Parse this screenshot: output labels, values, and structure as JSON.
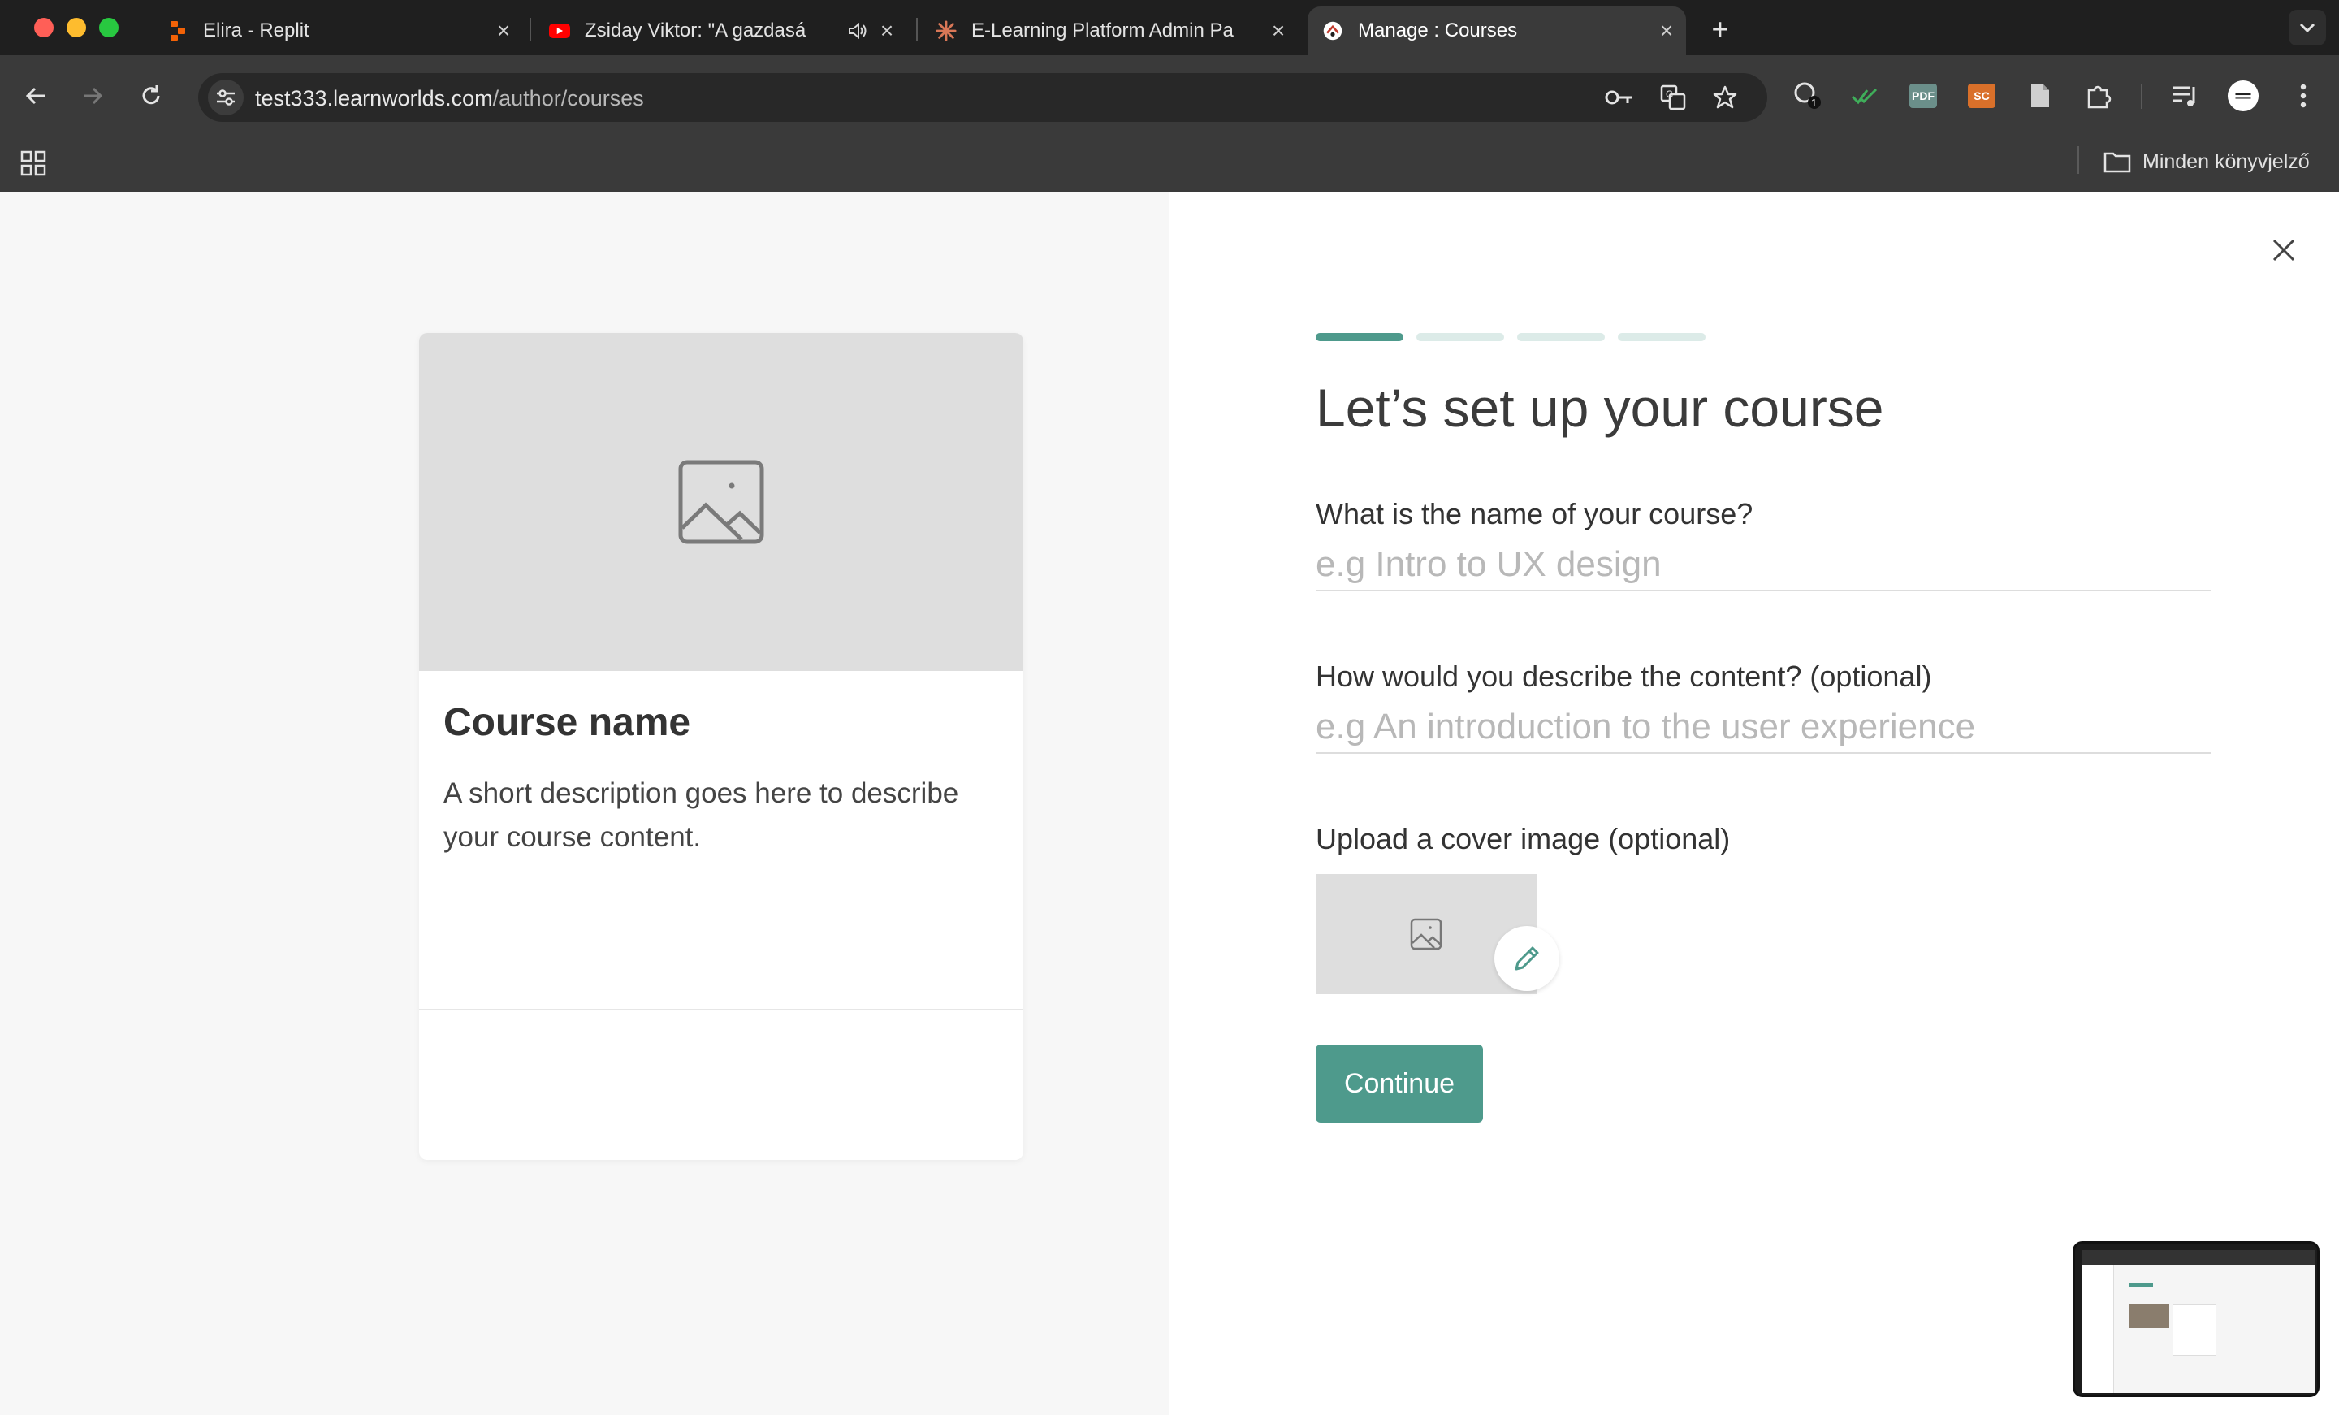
{
  "browser": {
    "tabs": [
      {
        "title": "Elira - Replit",
        "favicon": "replit-icon",
        "active": false
      },
      {
        "title": "Zsiday Viktor: \"A gazdasá",
        "favicon": "youtube-icon",
        "active": false,
        "audio": "speaker-icon"
      },
      {
        "title": "E-Learning Platform Admin Pa",
        "favicon": "claude-icon",
        "active": false
      },
      {
        "title": "Manage : Courses",
        "favicon": "learnworlds-icon",
        "active": true
      }
    ],
    "url_host": "test333.learnworlds.com",
    "url_path": "/author/courses",
    "extensions": {
      "ext_badge_count": "1",
      "pdf_label": "PDF",
      "sc_label": "SC"
    },
    "bookmarks_folder": "Minden könyvjelző",
    "colors": {
      "pdf": "#6b8f8a",
      "sc": "#d9702a",
      "check": "#3fae5a"
    }
  },
  "preview": {
    "course_name": "Course name",
    "description": "A short description goes here to describe your course content."
  },
  "wizard": {
    "step_current": 1,
    "step_total": 4,
    "heading": "Let’s set up your course",
    "name_label": "What is the name of your course?",
    "name_placeholder": "e.g Intro to UX design",
    "description_label": "How would you describe the content? (optional)",
    "description_placeholder": "e.g An introduction to the user experience",
    "cover_label": "Upload a cover image (optional)",
    "continue_label": "Continue",
    "accent_color": "#4e9a8c"
  }
}
